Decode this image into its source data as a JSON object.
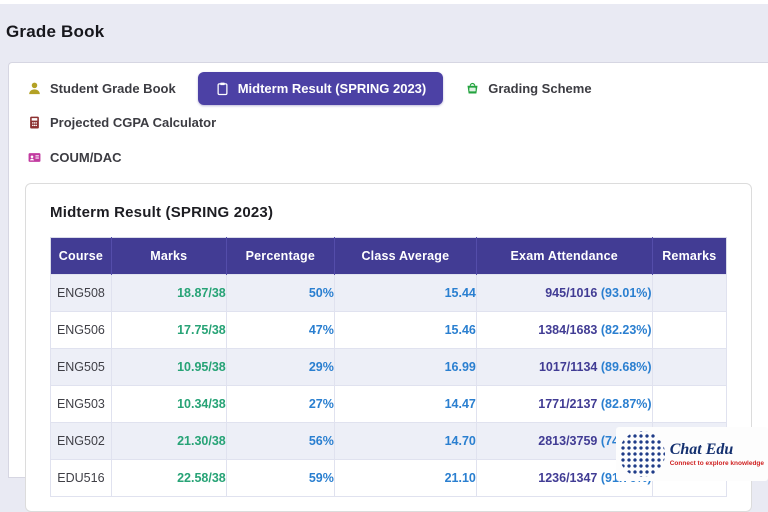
{
  "page": {
    "title": "Grade Book"
  },
  "tabs": [
    {
      "label": "Student Grade Book",
      "icon": "user-icon",
      "icon_color": "#b3a125",
      "active": false,
      "new_row": false
    },
    {
      "label": "Midterm Result (SPRING 2023)",
      "icon": "clipboard-icon",
      "icon_color": "#ffffff",
      "active": true,
      "new_row": false
    },
    {
      "label": "Grading Scheme",
      "icon": "grade-book-icon",
      "icon_color": "#23a33f",
      "active": false,
      "new_row": false
    },
    {
      "label": "Projected CGPA Calculator",
      "icon": "calculator-icon",
      "icon_color": "#8c3030",
      "active": false,
      "new_row": false
    },
    {
      "label": "COUM/DAC",
      "icon": "id-card-icon",
      "icon_color": "#c23ba0",
      "active": false,
      "new_row": true
    }
  ],
  "card": {
    "heading": "Midterm Result (SPRING 2023)"
  },
  "table": {
    "columns": [
      "Course",
      "Marks",
      "Percentage",
      "Class Average",
      "Exam Attendance",
      "Remarks"
    ],
    "rows": [
      {
        "course": "ENG508",
        "marks": "18.87/38",
        "percentage": "50%",
        "class_average": "15.44",
        "attendance_fraction": "945/1016",
        "attendance_percent": "(93.01%)",
        "remarks": ""
      },
      {
        "course": "ENG506",
        "marks": "17.75/38",
        "percentage": "47%",
        "class_average": "15.46",
        "attendance_fraction": "1384/1683",
        "attendance_percent": "(82.23%)",
        "remarks": ""
      },
      {
        "course": "ENG505",
        "marks": "10.95/38",
        "percentage": "29%",
        "class_average": "16.99",
        "attendance_fraction": "1017/1134",
        "attendance_percent": "(89.68%)",
        "remarks": ""
      },
      {
        "course": "ENG503",
        "marks": "10.34/38",
        "percentage": "27%",
        "class_average": "14.47",
        "attendance_fraction": "1771/2137",
        "attendance_percent": "(82.87%)",
        "remarks": ""
      },
      {
        "course": "ENG502",
        "marks": "21.30/38",
        "percentage": "56%",
        "class_average": "14.70",
        "attendance_fraction": "2813/3759",
        "attendance_percent": "(74.83%)",
        "remarks": ""
      },
      {
        "course": "EDU516",
        "marks": "22.58/38",
        "percentage": "59%",
        "class_average": "21.10",
        "attendance_fraction": "1236/1347",
        "attendance_percent": "(91.76%)",
        "remarks": ""
      }
    ]
  },
  "watermark": {
    "brand": "Chat Edu",
    "tagline": "Connect to explore knowledge"
  },
  "colors": {
    "accent_purple": "#4c41a5",
    "table_header": "#423c94",
    "marks_green": "#27a376",
    "value_blue": "#2a7fd0",
    "attendance_indigo": "#413c94",
    "page_background": "#e9eaf3"
  }
}
